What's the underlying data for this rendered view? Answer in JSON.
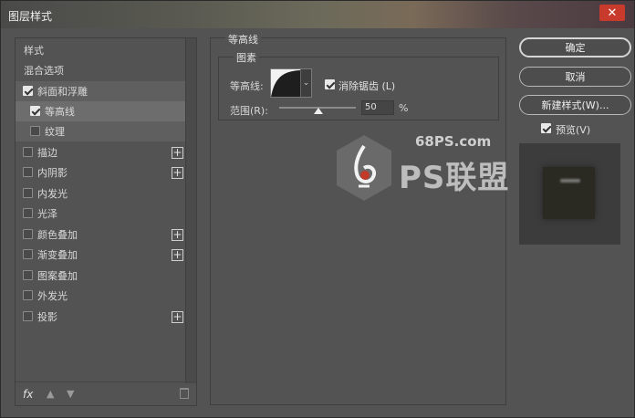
{
  "window": {
    "title": "图层样式",
    "close_label": "✕"
  },
  "left_panel": {
    "items": [
      {
        "label": "样式",
        "checkbox": false,
        "checked": false,
        "plus": false,
        "selected": ""
      },
      {
        "label": "混合选项",
        "checkbox": false,
        "checked": false,
        "plus": false,
        "selected": ""
      },
      {
        "label": "斜面和浮雕",
        "checkbox": true,
        "checked": true,
        "plus": false,
        "selected": "light"
      },
      {
        "label": "等高线",
        "checkbox": true,
        "checked": true,
        "plus": false,
        "selected": "strong"
      },
      {
        "label": "纹理",
        "checkbox": true,
        "checked": false,
        "plus": false,
        "selected": "light"
      },
      {
        "label": "描边",
        "checkbox": true,
        "checked": false,
        "plus": true,
        "selected": ""
      },
      {
        "label": "内阴影",
        "checkbox": true,
        "checked": false,
        "plus": true,
        "selected": ""
      },
      {
        "label": "内发光",
        "checkbox": true,
        "checked": false,
        "plus": false,
        "selected": ""
      },
      {
        "label": "光泽",
        "checkbox": true,
        "checked": false,
        "plus": false,
        "selected": ""
      },
      {
        "label": "颜色叠加",
        "checkbox": true,
        "checked": false,
        "plus": true,
        "selected": ""
      },
      {
        "label": "渐变叠加",
        "checkbox": true,
        "checked": false,
        "plus": true,
        "selected": ""
      },
      {
        "label": "图案叠加",
        "checkbox": true,
        "checked": false,
        "plus": false,
        "selected": ""
      },
      {
        "label": "外发光",
        "checkbox": true,
        "checked": false,
        "plus": false,
        "selected": ""
      },
      {
        "label": "投影",
        "checkbox": true,
        "checked": false,
        "plus": true,
        "selected": ""
      }
    ],
    "bottom": {
      "fx": "fx",
      "up_icon": "arrow-up-icon",
      "down_icon": "arrow-down-icon",
      "trash_icon": "trash-icon"
    }
  },
  "contour_panel": {
    "group_title": "等高线",
    "subgroup_title": "图素",
    "contour_label": "等高线:",
    "antialias_label": "消除锯齿 (L)",
    "antialias_checked": true,
    "range_label": "范围(R):",
    "range_value": "50",
    "range_unit": "%"
  },
  "watermark": {
    "site": "68PS.com",
    "brand": "PS联盟"
  },
  "buttons": {
    "ok": "确定",
    "cancel": "取消",
    "new_style": "新建样式(W)..."
  },
  "preview": {
    "label": "预览(V)",
    "checked": true
  },
  "colors": {
    "panel_bg": "#535353",
    "close_red": "#c83a2b",
    "watermark_red": "#c0392b"
  }
}
